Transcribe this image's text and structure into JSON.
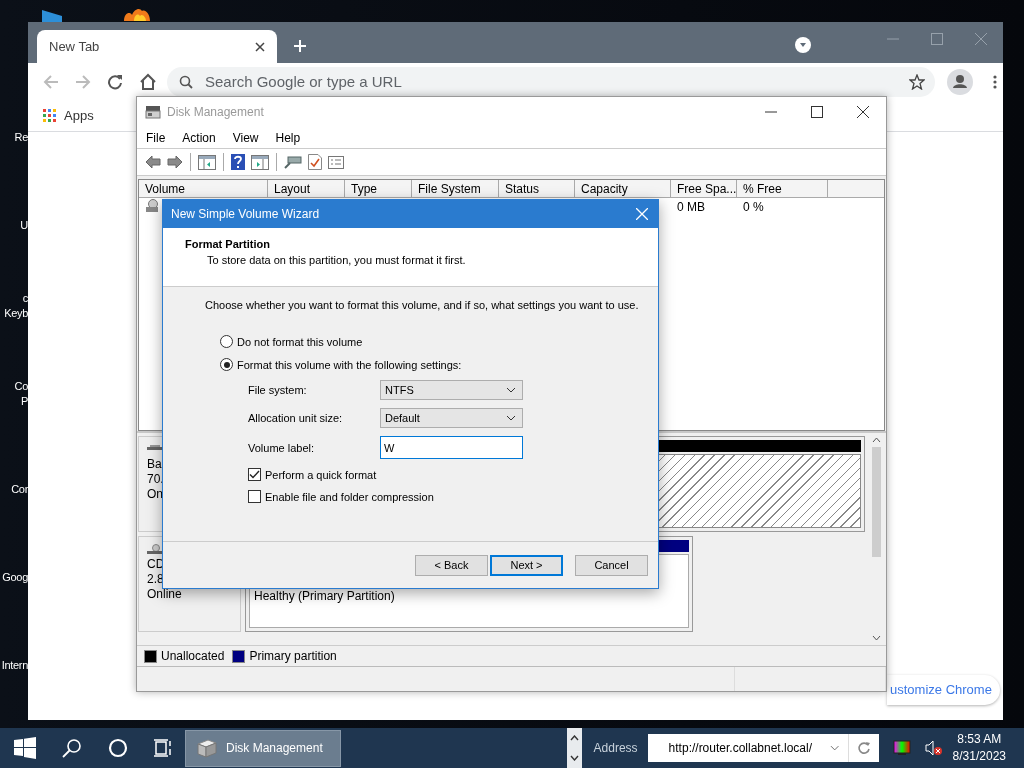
{
  "desktop": {
    "icons": [
      {
        "lines": [
          "Re"
        ]
      },
      {
        "lines": [
          "U"
        ]
      },
      {
        "lines": [
          "c",
          "Keyb"
        ]
      },
      {
        "lines": [
          "Co",
          "P"
        ]
      },
      {
        "lines": [
          "Cor"
        ]
      },
      {
        "lines": [
          "Goog"
        ]
      },
      {
        "lines": [
          "Intern"
        ]
      }
    ]
  },
  "browser": {
    "tab": {
      "title": "New Tab",
      "selected": true
    },
    "omnibox": {
      "placeholder": "Search Google or type a URL"
    },
    "bookmarks": [
      {
        "label": "Apps"
      }
    ],
    "customize": {
      "label": "ustomize Chrome"
    }
  },
  "disk_management": {
    "title": "Disk Management",
    "menu": [
      {
        "label": "File"
      },
      {
        "label": "Action"
      },
      {
        "label": "View"
      },
      {
        "label": "Help"
      }
    ],
    "columns": [
      "Volume",
      "Layout",
      "Type",
      "File System",
      "Status",
      "Capacity",
      "Free Spa...",
      "% Free"
    ],
    "rows": [
      {
        "free_space": "0 MB",
        "percent_free": "0 %"
      }
    ],
    "disks": [
      {
        "lines": [
          "Ba",
          "70.",
          "On"
        ],
        "kind": "disk",
        "partition": {
          "kind": "unallocated"
        }
      },
      {
        "lines": [
          "CD",
          "2.8",
          "Online"
        ],
        "kind": "cdrom",
        "partition": {
          "kind": "primary",
          "status": "Healthy (Primary Partition)"
        }
      }
    ],
    "legend": [
      {
        "label": "Unallocated",
        "color": "#000000"
      },
      {
        "label": "Primary partition",
        "color": "#000080"
      }
    ]
  },
  "wizard": {
    "title": "New Simple Volume Wizard",
    "heading": "Format Partition",
    "subheading": "To store data on this partition, you must format it first.",
    "prompt": "Choose whether you want to format this volume, and if so, what settings you want to use.",
    "options": [
      {
        "label": "Do not format this volume",
        "selected": false
      },
      {
        "label": "Format this volume with the following settings:",
        "selected": true
      }
    ],
    "fields": [
      {
        "label": "File system:",
        "kind": "dropdown",
        "value": "NTFS"
      },
      {
        "label": "Allocation unit size:",
        "kind": "dropdown",
        "value": "Default"
      },
      {
        "label": "Volume label:",
        "kind": "text",
        "value": "W",
        "focused": true
      }
    ],
    "checkboxes": [
      {
        "label": "Perform a quick format",
        "checked": true
      },
      {
        "label": "Enable file and folder compression",
        "checked": false
      }
    ],
    "buttons": [
      {
        "label": "< Back",
        "default": false
      },
      {
        "label": "Next >",
        "default": true
      },
      {
        "label": "Cancel",
        "default": false
      }
    ]
  },
  "taskbar": {
    "apps": [
      {
        "label": "Disk Management",
        "selected": true
      }
    ],
    "address": {
      "label": "Address",
      "value": "http://router.collabnet.local/"
    },
    "clock": {
      "time": "8:53 AM",
      "date": "8/31/2023"
    }
  }
}
